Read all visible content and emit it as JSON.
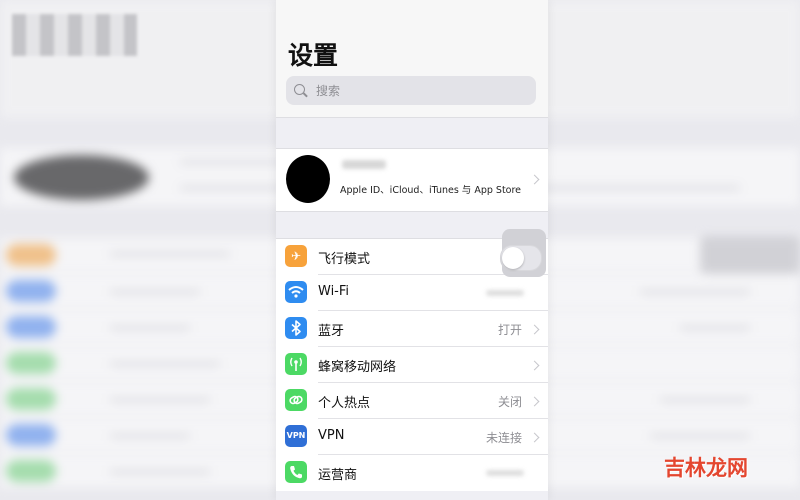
{
  "settings": {
    "title": "设置",
    "search_placeholder": "搜索"
  },
  "profile": {
    "subtitle": "Apple ID、iCloud、iTunes 与 App Store"
  },
  "items": [
    {
      "label": "飞行模式",
      "value": "",
      "icon": "airplane-icon",
      "color": "#f7a23b"
    },
    {
      "label": "Wi-Fi",
      "value": "",
      "icon": "wifi-icon",
      "color": "#2f8cf0"
    },
    {
      "label": "蓝牙",
      "value": "打开",
      "icon": "bluetooth-icon",
      "color": "#2f8cf0"
    },
    {
      "label": "蜂窝移动网络",
      "value": "",
      "icon": "cellular-icon",
      "color": "#4cd964"
    },
    {
      "label": "个人热点",
      "value": "关闭",
      "icon": "hotspot-icon",
      "color": "#4cd964"
    },
    {
      "label": "VPN",
      "value": "未连接",
      "icon": "vpn-icon",
      "color": "#2f6fd6"
    },
    {
      "label": "运营商",
      "value": "",
      "icon": "phone-icon",
      "color": "#4cd964"
    }
  ],
  "watermark": "吉林龙网"
}
